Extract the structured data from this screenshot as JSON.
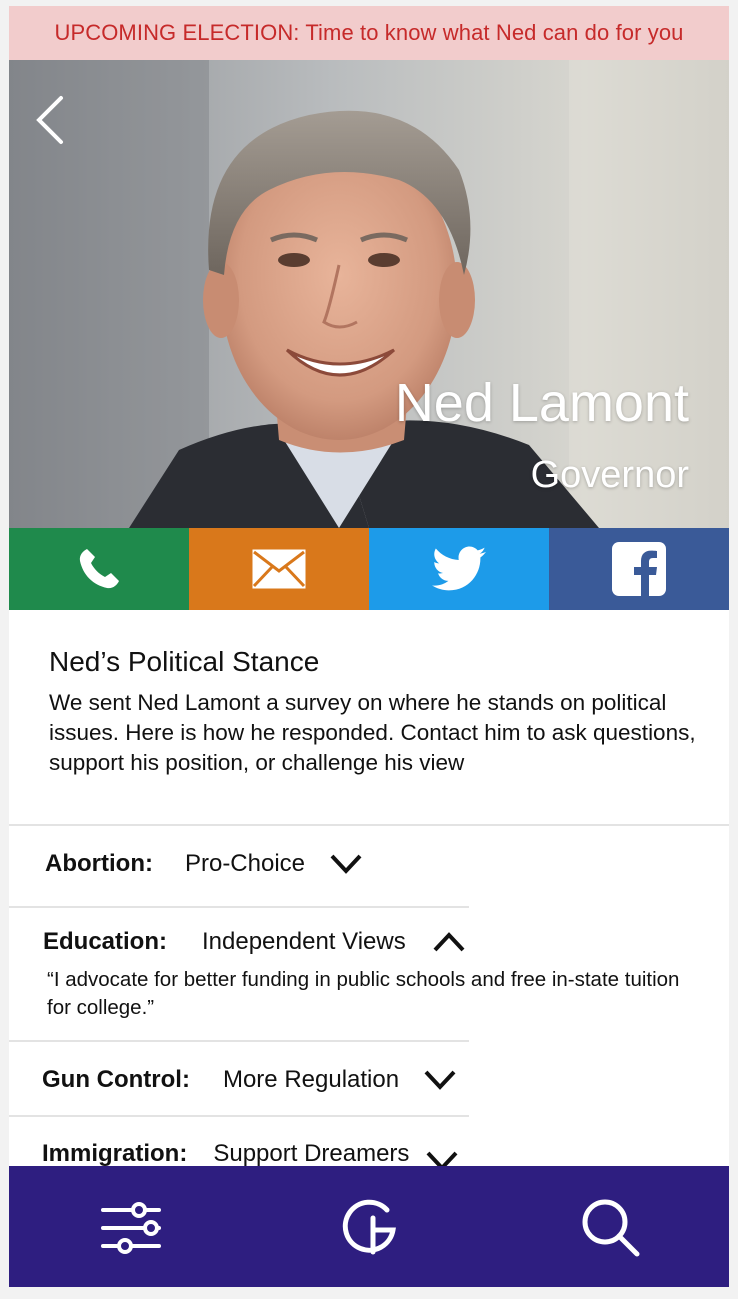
{
  "banner": {
    "text": "UPCOMING ELECTION: Time to know what Ned can do for you"
  },
  "profile": {
    "name": "Ned Lamont",
    "title": "Governor"
  },
  "contact": {
    "buttons": [
      {
        "icon": "phone-icon",
        "color": "#1f8a4c"
      },
      {
        "icon": "mail-icon",
        "color": "#d9781b"
      },
      {
        "icon": "twitter-icon",
        "color": "#1d9be9"
      },
      {
        "icon": "facebook-icon",
        "color": "#3a5a98"
      }
    ]
  },
  "stance": {
    "heading": "Ned’s Political Stance",
    "body": "We sent Ned Lamont a survey on where he stands on political issues. Here is how he responded. Contact him to ask questions, support his position, or challenge his view"
  },
  "issues": [
    {
      "label": "Abortion:",
      "value": "Pro-Choice",
      "expanded": false
    },
    {
      "label": "Education:",
      "value": "Independent Views",
      "expanded": true,
      "quote": "“I advocate for better funding in public schools and free in-state tuition for college.”"
    },
    {
      "label": "Gun Control:",
      "value": "More Regulation",
      "expanded": false
    },
    {
      "label": "Immigration:",
      "value": "Support Dreamers",
      "expanded": false
    }
  ],
  "nav": {
    "items": [
      {
        "icon": "filters-icon"
      },
      {
        "icon": "logo-g-icon"
      },
      {
        "icon": "search-icon"
      }
    ],
    "color": "#2e1e80"
  }
}
